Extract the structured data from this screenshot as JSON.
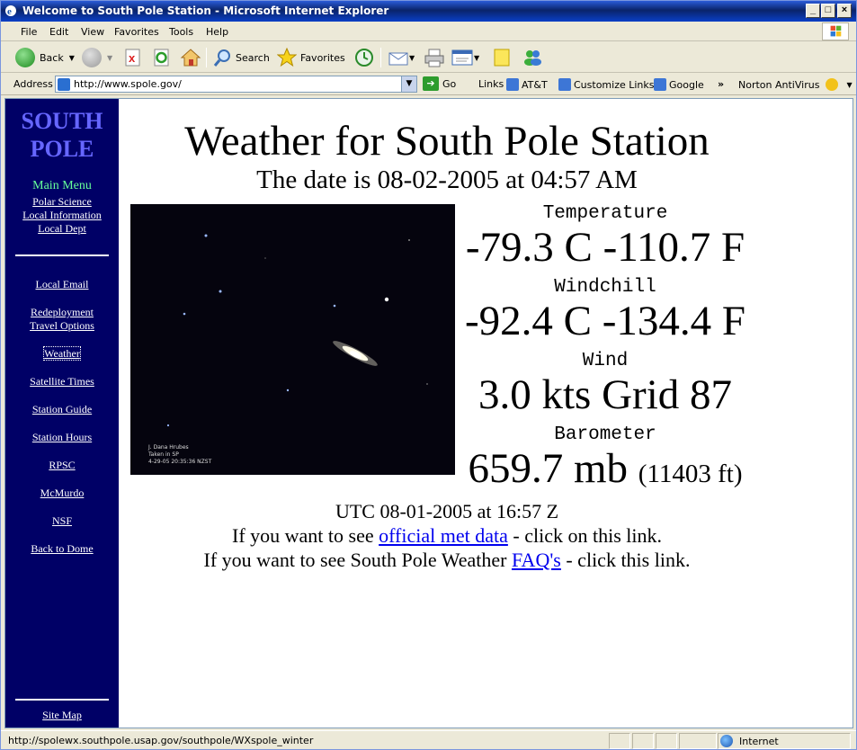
{
  "window": {
    "title": "Welcome to South Pole Station - Microsoft Internet Explorer",
    "controls": {
      "minimize": "_",
      "maximize": "□",
      "close": "×"
    }
  },
  "menubar": [
    "File",
    "Edit",
    "View",
    "Favorites",
    "Tools",
    "Help"
  ],
  "toolbar": {
    "back": "Back",
    "search": "Search",
    "favorites": "Favorites"
  },
  "addressbar": {
    "label": "Address",
    "url": "http://www.spole.gov/",
    "go": "Go",
    "links_label": "Links",
    "links": [
      "AT&T",
      "Customize Links",
      "Google"
    ],
    "chevron": "»",
    "norton": "Norton AntiVirus"
  },
  "sidebar": {
    "title_line1": "SOUTH",
    "title_line2": "POLE",
    "main_menu": "Main Menu",
    "top_links": [
      "Polar Science",
      "Local Information",
      "Local Dept"
    ],
    "links": [
      "Local Email",
      "Redeployment",
      "Travel Options",
      "Weather",
      "Satellite Times",
      "Station Guide",
      "Station Hours",
      "RPSC",
      "McMurdo",
      "NSF",
      "Back to Dome"
    ],
    "site_map": "Site Map"
  },
  "page": {
    "title": "Weather for South Pole Station",
    "date_line": "The date is 08-02-2005 at 04:57 AM",
    "photo_credit": [
      "J. Dana Hrubes",
      "Taken in SP",
      "4-29-05  20:35:36 NZST"
    ],
    "temperature_label": "Temperature",
    "temperature_value": "-79.3 C -110.7 F",
    "windchill_label": "Windchill",
    "windchill_value": "-92.4 C  -134.4 F",
    "wind_label": "Wind",
    "wind_value": "3.0 kts Grid 87",
    "barometer_label": "Barometer",
    "barometer_value": "659.7 mb",
    "barometer_alt": "(11403 ft)",
    "utc_line": "UTC 08-01-2005 at 16:57 Z",
    "line1_pre": "If you want to see ",
    "line1_link": "official met data",
    "line1_post": " - click on this link.",
    "line2_pre": "If you want to see South Pole Weather ",
    "line2_link": "FAQ's",
    "line2_post": " - click this link."
  },
  "statusbar": {
    "text": "http://spolewx.southpole.usap.gov/southpole/WXspole_winter",
    "zone": "Internet"
  }
}
